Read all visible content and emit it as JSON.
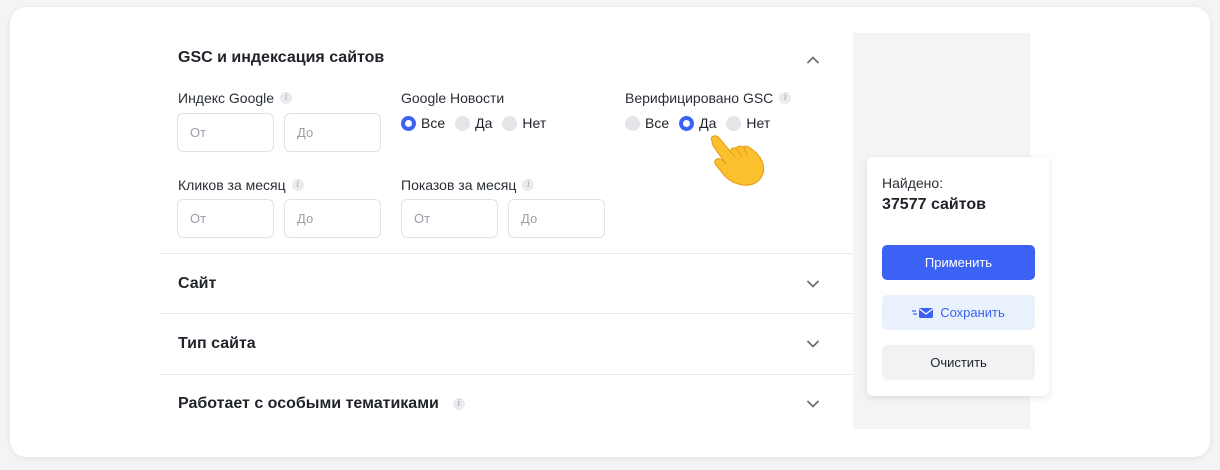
{
  "gsc_section": {
    "title": "GSC и индексация сайтов",
    "google_index": {
      "label": "Индекс Google",
      "from_placeholder": "От",
      "to_placeholder": "До"
    },
    "google_news": {
      "label": "Google Новости",
      "options": [
        "Все",
        "Да",
        "Нет"
      ],
      "selected": "Все"
    },
    "gsc_verified": {
      "label": "Верифицировано GSC",
      "options": [
        "Все",
        "Да",
        "Нет"
      ],
      "selected": "Да"
    },
    "clicks_per_month": {
      "label": "Кликов за месяц",
      "from_placeholder": "От",
      "to_placeholder": "До"
    },
    "impressions_per_month": {
      "label": "Показов за месяц",
      "from_placeholder": "От",
      "to_placeholder": "До"
    }
  },
  "collapsed_sections": [
    {
      "title": "Сайт"
    },
    {
      "title": "Тип сайта"
    },
    {
      "title": "Работает с особыми тематиками"
    }
  ],
  "results_panel": {
    "found_label": "Найдено:",
    "found_count": "37577 сайтов",
    "apply_label": "Применить",
    "save_label": "Сохранить",
    "clear_label": "Очистить"
  },
  "icons": {
    "info": "info-icon",
    "expand_up": "chevron-up-icon",
    "expand_down": "chevron-down-icon",
    "save": "mail-icon",
    "pointer": "hand-pointer-icon"
  },
  "colors": {
    "accent": "#3c62f5",
    "save_bg": "#e9f1fd",
    "clear_bg": "#f1f2f4",
    "sidebar_bg": "#f3f4f6"
  }
}
